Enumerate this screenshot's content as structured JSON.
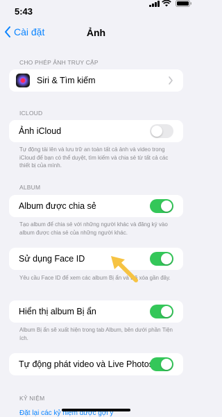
{
  "status": {
    "time": "5:43"
  },
  "nav": {
    "back_label": "Cài đặt",
    "title": "Ảnh"
  },
  "access": {
    "header": "CHO PHÉP ẢNH TRUY CẬP",
    "siri_label": "Siri & Tìm kiếm"
  },
  "icloud": {
    "header": "ICLOUD",
    "row_label": "Ảnh iCloud",
    "row_state": "off",
    "footer": "Tự động tải lên và lưu trữ an toàn tất cả ảnh và video trong iCloud để bạn có thể duyệt, tìm kiếm và chia sẻ từ tất cả các thiết bị của mình."
  },
  "album": {
    "header": "ALBUM",
    "shared_label": "Album được chia sẻ",
    "shared_state": "on",
    "shared_footer": "Tạo album để chia sẻ với những người khác và đăng ký vào album được chia sẻ của những người khác.",
    "faceid_label": "Sử dụng Face ID",
    "faceid_state": "on",
    "faceid_footer": "Yêu cầu Face ID để xem các album Bị ẩn và Đã xóa gần đây.",
    "hidden_label": "Hiển thị album Bị ẩn",
    "hidden_state": "on",
    "hidden_footer": "Album Bị ẩn sẽ xuất hiện trong tab Album, bên dưới phần Tiện ích.",
    "autoplay_label": "Tự động phát video và Live Photos",
    "autoplay_state": "on"
  },
  "memories": {
    "header": "KỶ NIỆM",
    "reset_label": "Đặt lại các kỷ niệm được gợi ý"
  },
  "colors": {
    "accent": "#0a84ff",
    "toggle_on": "#34c759",
    "toggle_off": "#e9e9eb",
    "arrow": "#f6c343"
  }
}
